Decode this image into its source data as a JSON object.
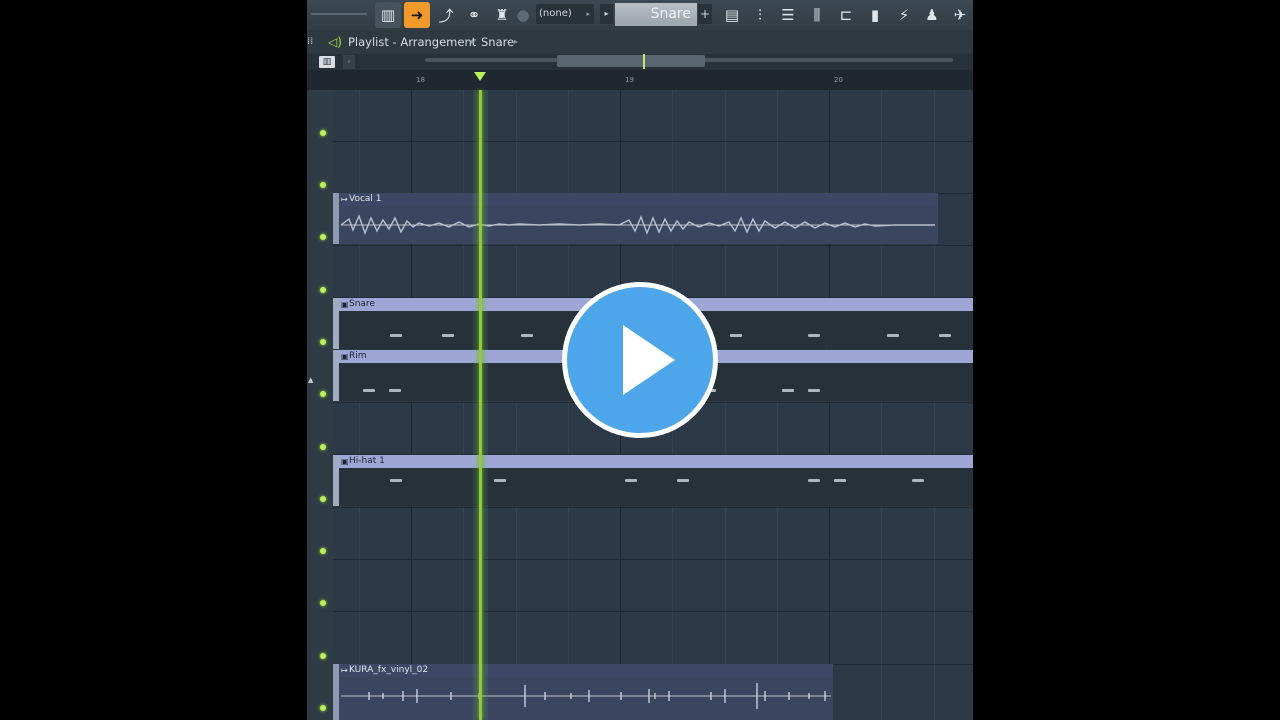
{
  "toolbar": {
    "pattern_selector_value": "(none)",
    "pattern_name": "Snare",
    "add_label": "+",
    "step_label": "▸"
  },
  "titlebar": {
    "title": "Playlist - Arrangement",
    "separator": "▸",
    "crumb": "Snare"
  },
  "overview": {
    "piano_icon_label": "▥",
    "collapse_label": "‹"
  },
  "ruler": {
    "bars": [
      "18",
      "19",
      "20"
    ]
  },
  "clips": {
    "vocal": "Vocal 1",
    "snare": "Snare",
    "rim": "Rim",
    "hihat": "Hi-hat 1",
    "vinyl": "KURA_fx_vinyl_02"
  },
  "colors": {
    "background": "#2c3a47",
    "playhead": "#8fcc3a",
    "accent_tool": "#f09a2c",
    "pattern_clip_header": "#9ea6d6",
    "audio_clip_header": "#3d4866",
    "play_button": "#4da6ea"
  },
  "icons": [
    "menu-icon",
    "speaker-icon",
    "piano-roll-icon",
    "arrow-tool-icon",
    "draw-icon",
    "link-icon",
    "stamp-icon",
    "playlist-icon",
    "step-seq-icon",
    "channel-rack-icon",
    "mixer-icon",
    "browser-icon",
    "file-icon",
    "plugin-icon",
    "user-icon",
    "snap-icon",
    "play-video-icon"
  ]
}
